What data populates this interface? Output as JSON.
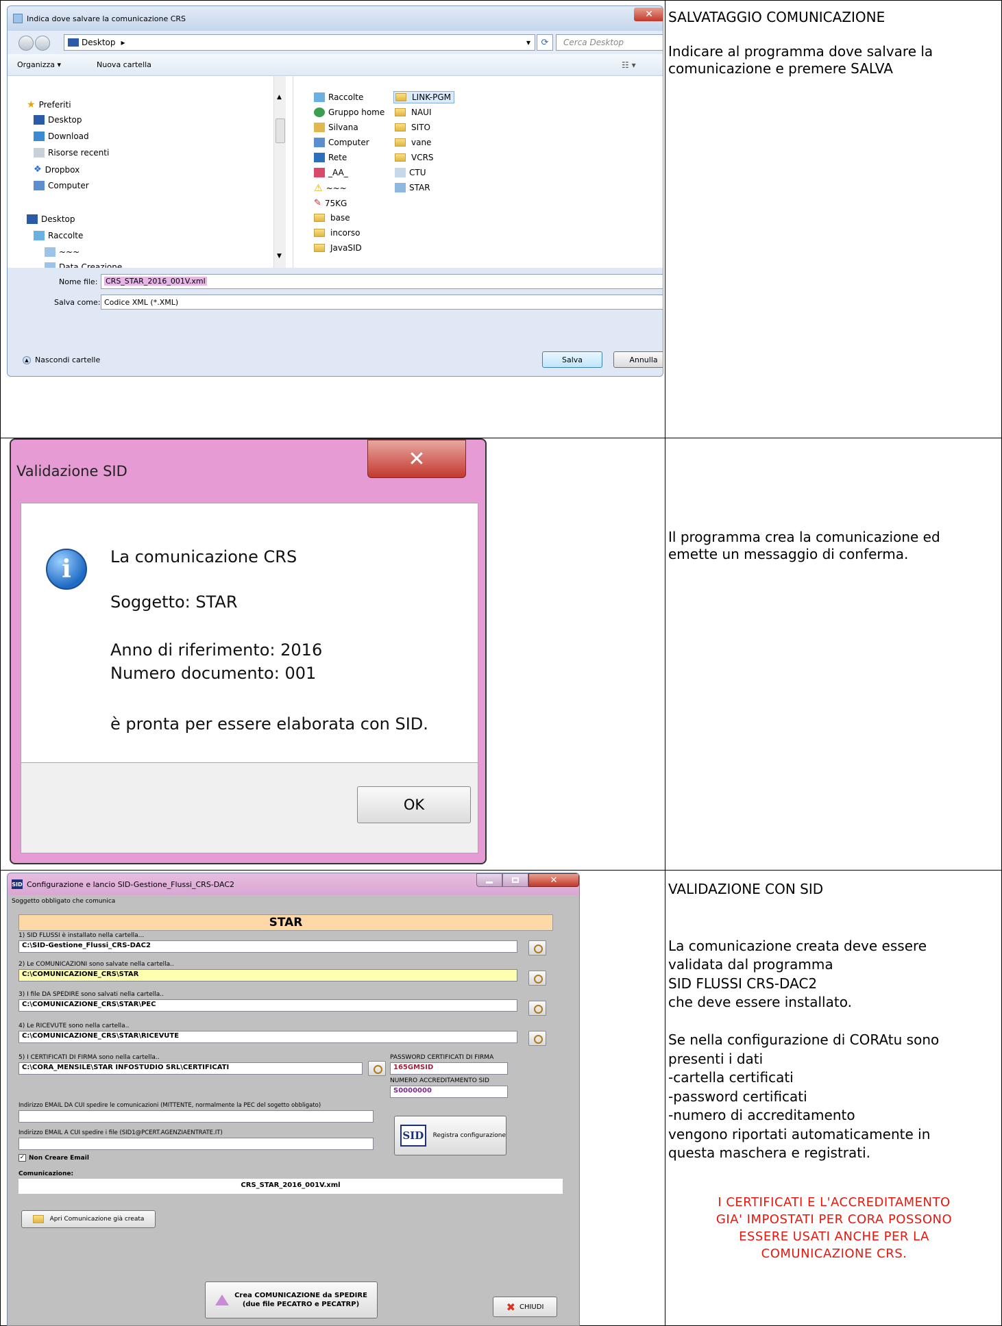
{
  "colors": {
    "win7_title": "#c7d7ec",
    "pink_frame": "#e69bd4",
    "red_note": "#e8160c",
    "star_banner": "#ffd8a8",
    "yellow_field": "#ffffb0"
  },
  "row1": {
    "right_text": "SALVATAGGIO COMUNICAZIONE\n\nIndicare al programma dove salvare la\ncomunicazione e premere SALVA",
    "dialog": {
      "title": "Indica dove salvare la comunicazione CRS",
      "breadcrumb": "Desktop",
      "search_placeholder": "Cerca Desktop",
      "toolbar": {
        "organize": "Organizza ▾",
        "new_folder": "Nuova cartella"
      },
      "nav": [
        "Preferiti",
        "Desktop",
        "Download",
        "Risorse recenti",
        "Dropbox",
        "Computer",
        "Desktop",
        "Raccolte",
        "~~~",
        "Data Creazione"
      ],
      "files_col1": [
        "Raccolte",
        "Gruppo home",
        "Silvana",
        "Computer",
        "Rete",
        "_AA_",
        "~~~",
        "75KG",
        "base",
        "incorso",
        "JavaSID"
      ],
      "files_col2": [
        "LINK-PGM",
        "NAUI",
        "SITO",
        "vane",
        "VCRS",
        "CTU",
        "STAR"
      ],
      "filename_label": "Nome file:",
      "filename_value": "CRS_STAR_2016_001V.xml",
      "savetype_label": "Salva come:",
      "savetype_value": "Codice XML (*.XML)",
      "hide_folders": "Nascondi cartelle",
      "save_btn": "Salva",
      "cancel_btn": "Annulla"
    }
  },
  "row2": {
    "right_text": "Il programma crea la comunicazione ed\nemette un messaggio di conferma.",
    "msgbox": {
      "title": "Validazione SID",
      "line1": "La comunicazione CRS",
      "line2": "Soggetto: STAR",
      "line3": "Anno di riferimento: 2016",
      "line4": "Numero documento: 001",
      "line5": "è pronta per essere elaborata con SID.",
      "ok": "OK"
    }
  },
  "row3": {
    "right_text": "VALIDAZIONE CON SID\n\n\nLa comunicazione creata deve essere\nvalidata dal programma\nSID FLUSSI CRS-DAC2\nche deve essere installato.\n\nSe nella configurazione di CORAtu sono\npresenti i dati\n-cartella certificati\n-password certificati\n-numero di accreditamento\nvengono riportati automaticamente in\nquesta maschera e registrati.",
    "red_note": "I CERTIFICATI E L'ACCREDITAMENTO\nGIA' IMPOSTATI PER CORA POSSONO\nESSERE USATI ANCHE PER LA\nCOMUNICAZIONE CRS.",
    "config": {
      "title": "Configurazione e lancio SID-Gestione_Flussi_CRS-DAC2",
      "subject_label": "Soggetto obbligato che comunica",
      "subject": "STAR",
      "l1": "1) SID FLUSSI è installato nella cartella...",
      "v1": "C:\\SID-Gestione_Flussi_CRS-DAC2",
      "l2": "2) Le COMUNICAZIONI sono salvate nella cartella..",
      "v2": "C:\\COMUNICAZIONE_CRS\\STAR",
      "l3": "3) I file DA SPEDIRE sono salvati nella cartella..",
      "v3": "C:\\COMUNICAZIONE_CRS\\STAR\\PEC",
      "l4": "4) Le RICEVUTE sono nella cartella..",
      "v4": "C:\\COMUNICAZIONE_CRS\\STAR\\RICEVUTE",
      "l5": "5) I CERTIFICATI DI FIRMA sono nella cartella..",
      "v5": "C:\\CORA_MENSILE\\STAR INFOSTUDIO SRL\\CERTIFICATI",
      "pwd_label": "PASSWORD CERTIFICATI DI FIRMA",
      "pwd": "165GMSID",
      "acc_label": "NUMERO ACCREDITAMENTO SID",
      "acc": "S0000000",
      "email_from_label": "Indirizzo EMAIL DA CUI spedire le comunicazioni (MITTENTE, normalmente la PEC del sogetto obbligato)",
      "email_to_label": "Indirizzo EMAIL A CUI spedire i file (SID1@PCERT.AGENZIAENTRATE.IT)",
      "register_btn": "Registra configurazione",
      "no_email": "Non Creare Email",
      "comm_label": "Comunicazione:",
      "comm_value": "CRS_STAR_2016_001V.xml",
      "open_btn": "Apri Comunicazione già creata",
      "create_btn_l1": "Crea COMUNICAZIONE da SPEDIRE",
      "create_btn_l2": "(due file PECATRO e PECATRP)",
      "close_btn": "CHIUDI",
      "sid_logo": "SID"
    }
  }
}
